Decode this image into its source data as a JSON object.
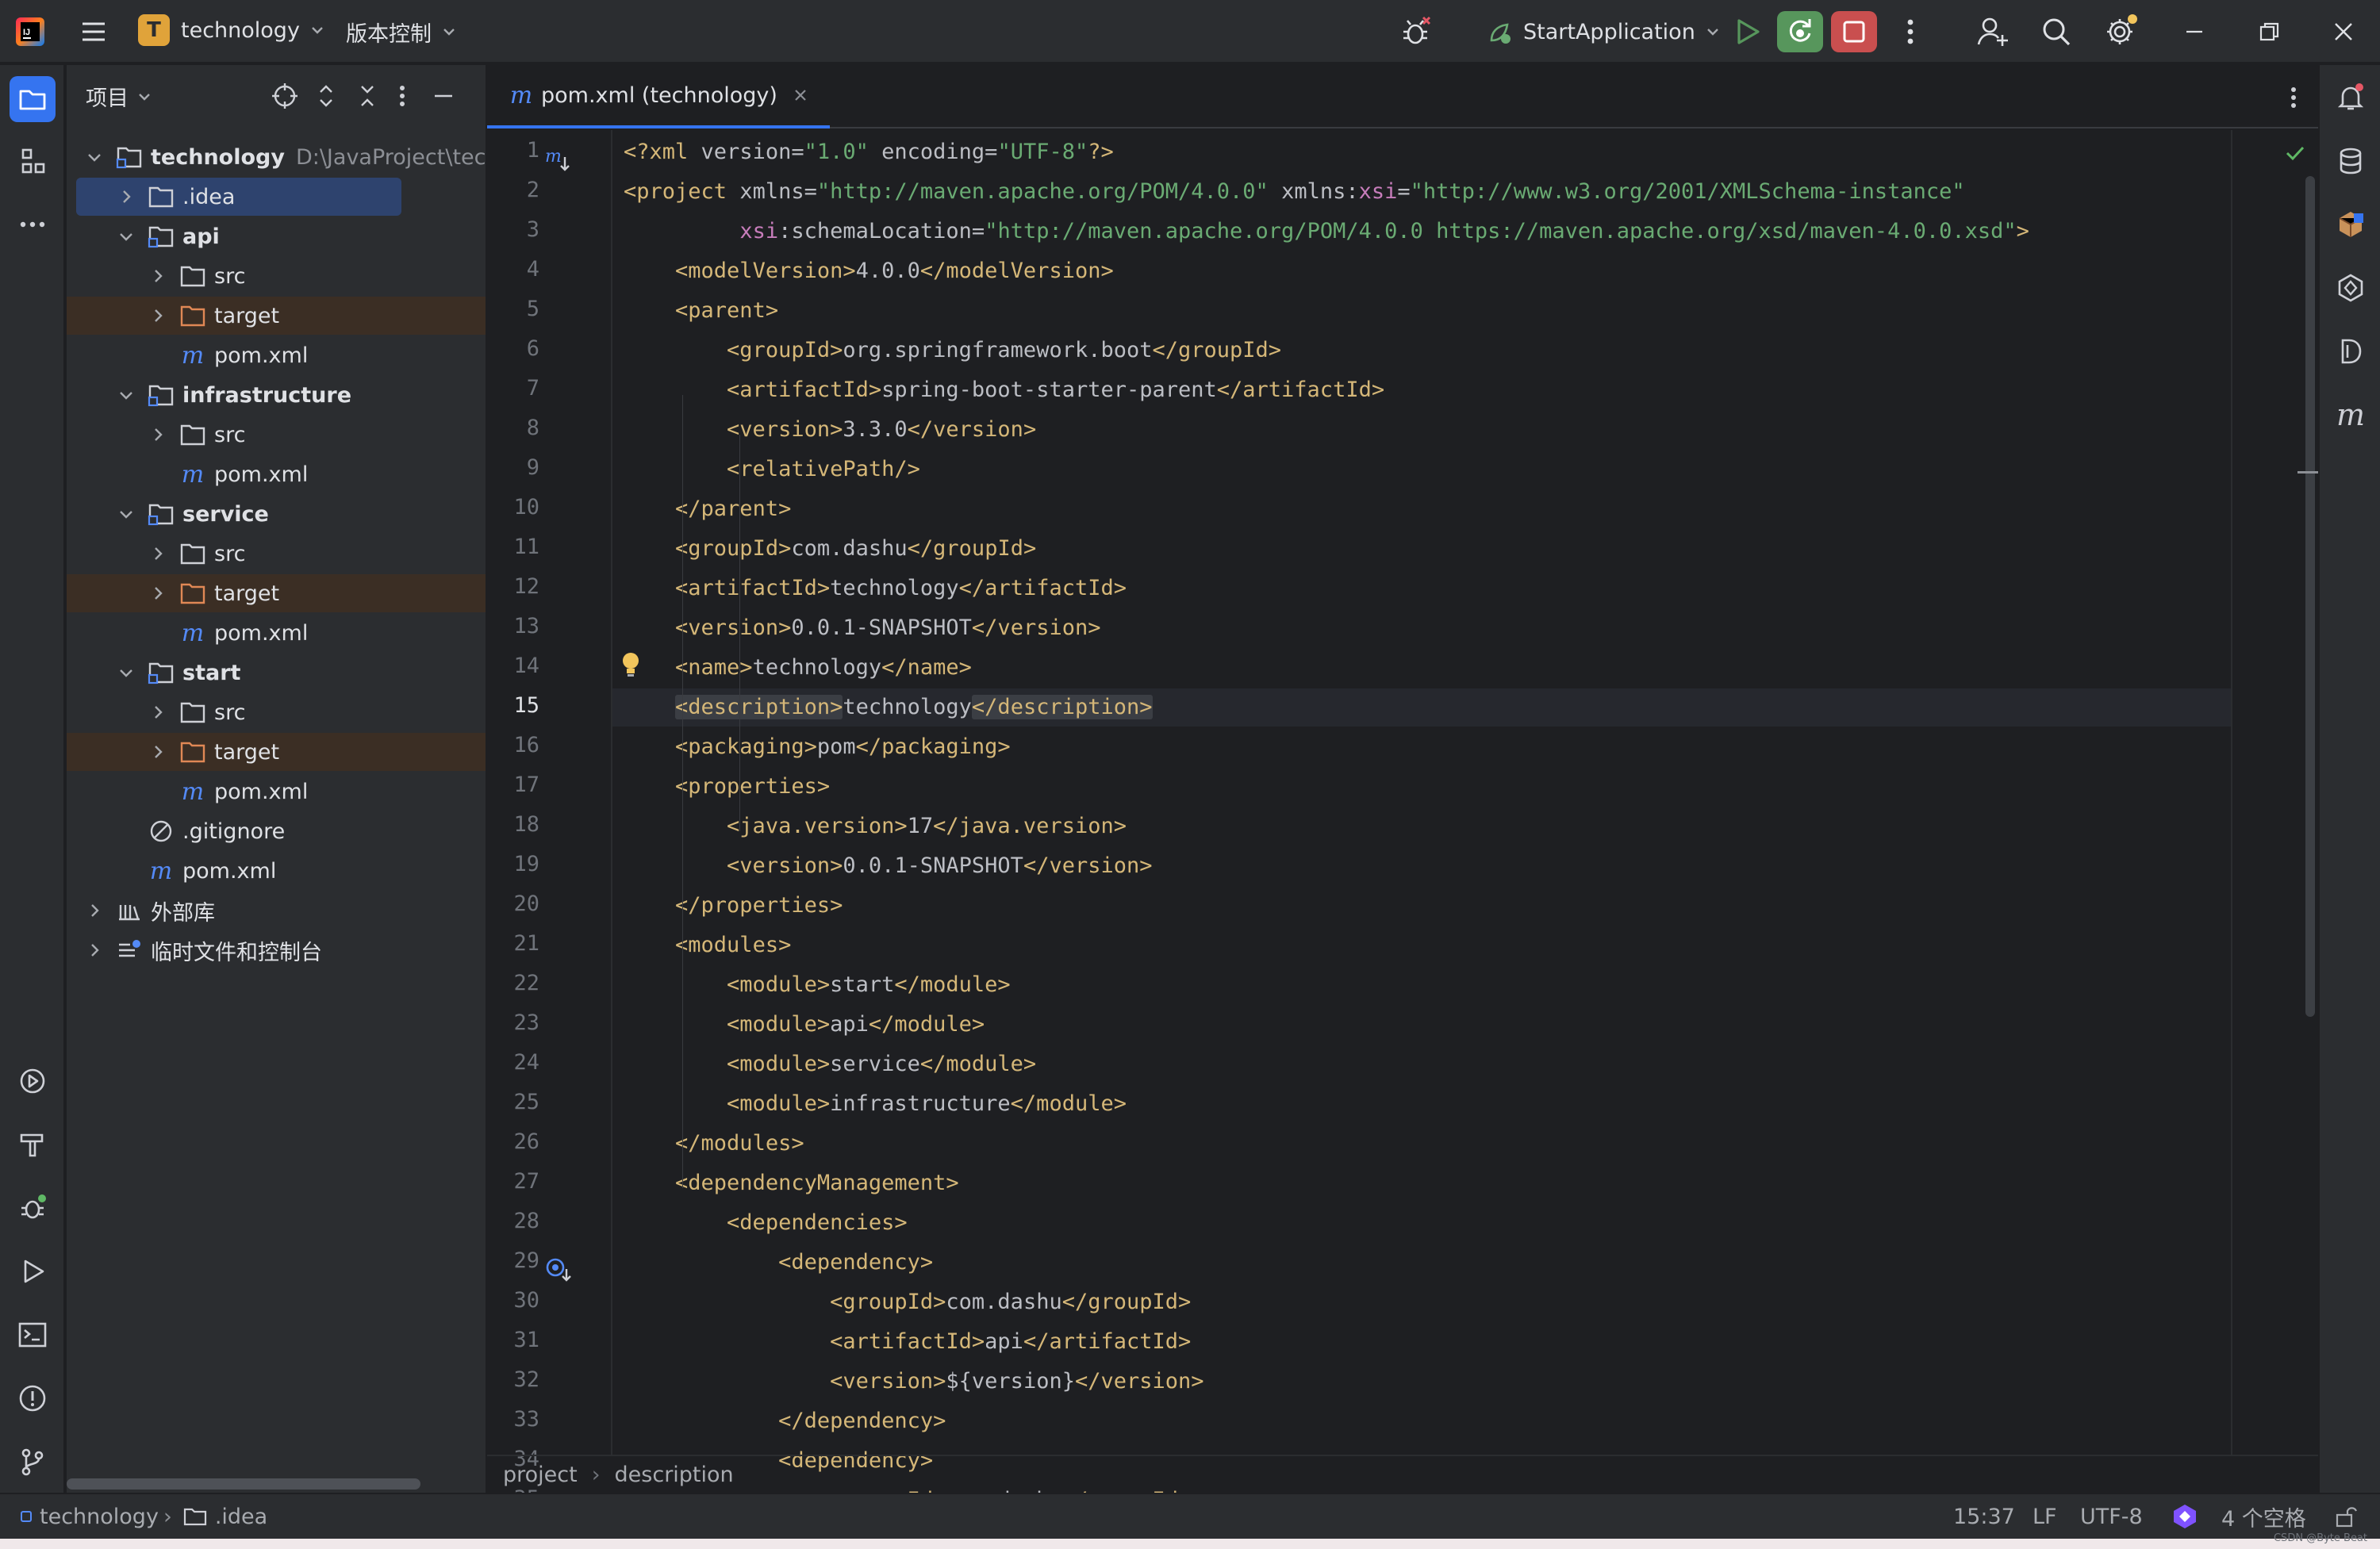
{
  "titlebar": {
    "project_initial": "T",
    "project_name": "technology",
    "vcs_label": "版本控制",
    "run_config": "StartApplication"
  },
  "colors": {
    "accent": "#3574f0",
    "run_green": "#57965c",
    "stop_red": "#c94f4f",
    "project_badge": "#e0a33a"
  },
  "project_panel": {
    "title": "项目",
    "tree": [
      {
        "label": "technology",
        "path": "D:\\JavaProject\\technology",
        "kind": "module",
        "depth": 0,
        "expanded": true,
        "bold": true
      },
      {
        "label": ".idea",
        "kind": "folder",
        "depth": 1,
        "expanded": false,
        "selected": true
      },
      {
        "label": "api",
        "kind": "module",
        "depth": 1,
        "expanded": true,
        "bold": true
      },
      {
        "label": "src",
        "kind": "folder",
        "depth": 2,
        "expanded": false
      },
      {
        "label": "target",
        "kind": "excluded",
        "depth": 2,
        "expanded": false
      },
      {
        "label": "pom.xml",
        "kind": "maven",
        "depth": 2
      },
      {
        "label": "infrastructure",
        "kind": "module",
        "depth": 1,
        "expanded": true,
        "bold": true
      },
      {
        "label": "src",
        "kind": "folder",
        "depth": 2,
        "expanded": false
      },
      {
        "label": "pom.xml",
        "kind": "maven",
        "depth": 2
      },
      {
        "label": "service",
        "kind": "module",
        "depth": 1,
        "expanded": true,
        "bold": true
      },
      {
        "label": "src",
        "kind": "folder",
        "depth": 2,
        "expanded": false
      },
      {
        "label": "target",
        "kind": "excluded",
        "depth": 2,
        "expanded": false
      },
      {
        "label": "pom.xml",
        "kind": "maven",
        "depth": 2
      },
      {
        "label": "start",
        "kind": "module",
        "depth": 1,
        "expanded": true,
        "bold": true
      },
      {
        "label": "src",
        "kind": "folder",
        "depth": 2,
        "expanded": false
      },
      {
        "label": "target",
        "kind": "excluded",
        "depth": 2,
        "expanded": false
      },
      {
        "label": "pom.xml",
        "kind": "maven",
        "depth": 2
      },
      {
        "label": ".gitignore",
        "kind": "ignore",
        "depth": 1
      },
      {
        "label": "pom.xml",
        "kind": "maven",
        "depth": 1
      },
      {
        "label": "外部库",
        "kind": "library",
        "depth": 0,
        "expanded": false
      },
      {
        "label": "临时文件和控制台",
        "kind": "scratch",
        "depth": 0,
        "expanded": false
      }
    ]
  },
  "editor": {
    "tab_label": "pom.xml (technology)",
    "current_line": 15,
    "lines": [
      [
        [
          "t",
          "<?xml "
        ],
        [
          "a",
          "version="
        ],
        [
          "v",
          "\"1.0\""
        ],
        [
          "a",
          " encoding="
        ],
        [
          "v",
          "\"UTF-8\""
        ],
        [
          "t",
          "?>"
        ]
      ],
      [
        [
          "t",
          "<project "
        ],
        [
          "a",
          "xmlns="
        ],
        [
          "v",
          "\"http://maven.apache.org/POM/4.0.0\""
        ],
        [
          "a",
          " xmlns:"
        ],
        [
          "ns",
          "xsi"
        ],
        [
          "a",
          "="
        ],
        [
          "v",
          "\"http://www.w3.org/2001/XMLSchema-instance\""
        ]
      ],
      [
        [
          "a",
          "         "
        ],
        [
          "ns",
          "xsi"
        ],
        [
          "a",
          ":schemaLocation="
        ],
        [
          "v",
          "\"http://maven.apache.org/POM/4.0.0 https://maven.apache.org/xsd/maven-4.0.0.xsd\""
        ],
        [
          "t",
          ">"
        ]
      ],
      [
        [
          "a",
          "    "
        ],
        [
          "t",
          "<modelVersion>"
        ],
        [
          "a",
          "4.0.0"
        ],
        [
          "t",
          "</modelVersion>"
        ]
      ],
      [
        [
          "a",
          "    "
        ],
        [
          "t",
          "<parent>"
        ]
      ],
      [
        [
          "a",
          "        "
        ],
        [
          "t",
          "<groupId>"
        ],
        [
          "a",
          "org.springframework.boot"
        ],
        [
          "t",
          "</groupId>"
        ]
      ],
      [
        [
          "a",
          "        "
        ],
        [
          "t",
          "<artifactId>"
        ],
        [
          "a",
          "spring-boot-starter-parent"
        ],
        [
          "t",
          "</artifactId>"
        ]
      ],
      [
        [
          "a",
          "        "
        ],
        [
          "t",
          "<version>"
        ],
        [
          "a",
          "3.3.0"
        ],
        [
          "t",
          "</version>"
        ]
      ],
      [
        [
          "a",
          "        "
        ],
        [
          "t",
          "<relativePath/>"
        ]
      ],
      [
        [
          "a",
          "    "
        ],
        [
          "t",
          "</parent>"
        ]
      ],
      [
        [
          "a",
          "    "
        ],
        [
          "t",
          "<groupId>"
        ],
        [
          "a",
          "com.dashu"
        ],
        [
          "t",
          "</groupId>"
        ]
      ],
      [
        [
          "a",
          "    "
        ],
        [
          "t",
          "<artifactId>"
        ],
        [
          "a",
          "technology"
        ],
        [
          "t",
          "</artifactId>"
        ]
      ],
      [
        [
          "a",
          "    "
        ],
        [
          "t",
          "<version>"
        ],
        [
          "a",
          "0.0.1-SNAPSHOT"
        ],
        [
          "t",
          "</version>"
        ]
      ],
      [
        [
          "a",
          "    "
        ],
        [
          "t",
          "<name>"
        ],
        [
          "a",
          "technology"
        ],
        [
          "t",
          "</name>"
        ]
      ],
      [
        [
          "a",
          "    "
        ],
        [
          "th",
          "<description>"
        ],
        [
          "a",
          "technology"
        ],
        [
          "th",
          "</description>"
        ]
      ],
      [
        [
          "a",
          "    "
        ],
        [
          "t",
          "<packaging>"
        ],
        [
          "a",
          "pom"
        ],
        [
          "t",
          "</packaging>"
        ]
      ],
      [
        [
          "a",
          "    "
        ],
        [
          "t",
          "<properties>"
        ]
      ],
      [
        [
          "a",
          "        "
        ],
        [
          "t",
          "<java.version>"
        ],
        [
          "a",
          "17"
        ],
        [
          "t",
          "</java.version>"
        ]
      ],
      [
        [
          "a",
          "        "
        ],
        [
          "t",
          "<version>"
        ],
        [
          "a",
          "0.0.1-SNAPSHOT"
        ],
        [
          "t",
          "</version>"
        ]
      ],
      [
        [
          "a",
          "    "
        ],
        [
          "t",
          "</properties>"
        ]
      ],
      [
        [
          "a",
          "    "
        ],
        [
          "t",
          "<modules>"
        ]
      ],
      [
        [
          "a",
          "        "
        ],
        [
          "t",
          "<module>"
        ],
        [
          "a",
          "start"
        ],
        [
          "t",
          "</module>"
        ]
      ],
      [
        [
          "a",
          "        "
        ],
        [
          "t",
          "<module>"
        ],
        [
          "a",
          "api"
        ],
        [
          "t",
          "</module>"
        ]
      ],
      [
        [
          "a",
          "        "
        ],
        [
          "t",
          "<module>"
        ],
        [
          "a",
          "service"
        ],
        [
          "t",
          "</module>"
        ]
      ],
      [
        [
          "a",
          "        "
        ],
        [
          "t",
          "<module>"
        ],
        [
          "a",
          "infrastructure"
        ],
        [
          "t",
          "</module>"
        ]
      ],
      [
        [
          "a",
          "    "
        ],
        [
          "t",
          "</modules>"
        ]
      ],
      [
        [
          "a",
          "    "
        ],
        [
          "t",
          "<dependencyManagement>"
        ]
      ],
      [
        [
          "a",
          "        "
        ],
        [
          "t",
          "<dependencies>"
        ]
      ],
      [
        [
          "a",
          "            "
        ],
        [
          "t",
          "<dependency>"
        ]
      ],
      [
        [
          "a",
          "                "
        ],
        [
          "t",
          "<groupId>"
        ],
        [
          "a",
          "com.dashu"
        ],
        [
          "t",
          "</groupId>"
        ]
      ],
      [
        [
          "a",
          "                "
        ],
        [
          "t",
          "<artifactId>"
        ],
        [
          "a",
          "api"
        ],
        [
          "t",
          "</artifactId>"
        ]
      ],
      [
        [
          "a",
          "                "
        ],
        [
          "t",
          "<version>"
        ],
        [
          "a",
          "${version}"
        ],
        [
          "t",
          "</version>"
        ]
      ],
      [
        [
          "a",
          "            "
        ],
        [
          "t",
          "</dependency>"
        ]
      ],
      [
        [
          "a",
          "            "
        ],
        [
          "t",
          "<dependency>"
        ]
      ],
      [
        [
          "a",
          "                "
        ],
        [
          "t",
          "<groupId>"
        ],
        [
          "a",
          "com.dashu"
        ],
        [
          "t",
          "</groupId>"
        ]
      ]
    ],
    "breadcrumb": [
      "project",
      "description"
    ]
  },
  "statusbar": {
    "project": "technology",
    "folder": ".idea",
    "position": "15:37",
    "line_separator": "LF",
    "encoding": "UTF-8",
    "indent": "4 个空格",
    "watermark": "CSDN @Byte Beat"
  }
}
